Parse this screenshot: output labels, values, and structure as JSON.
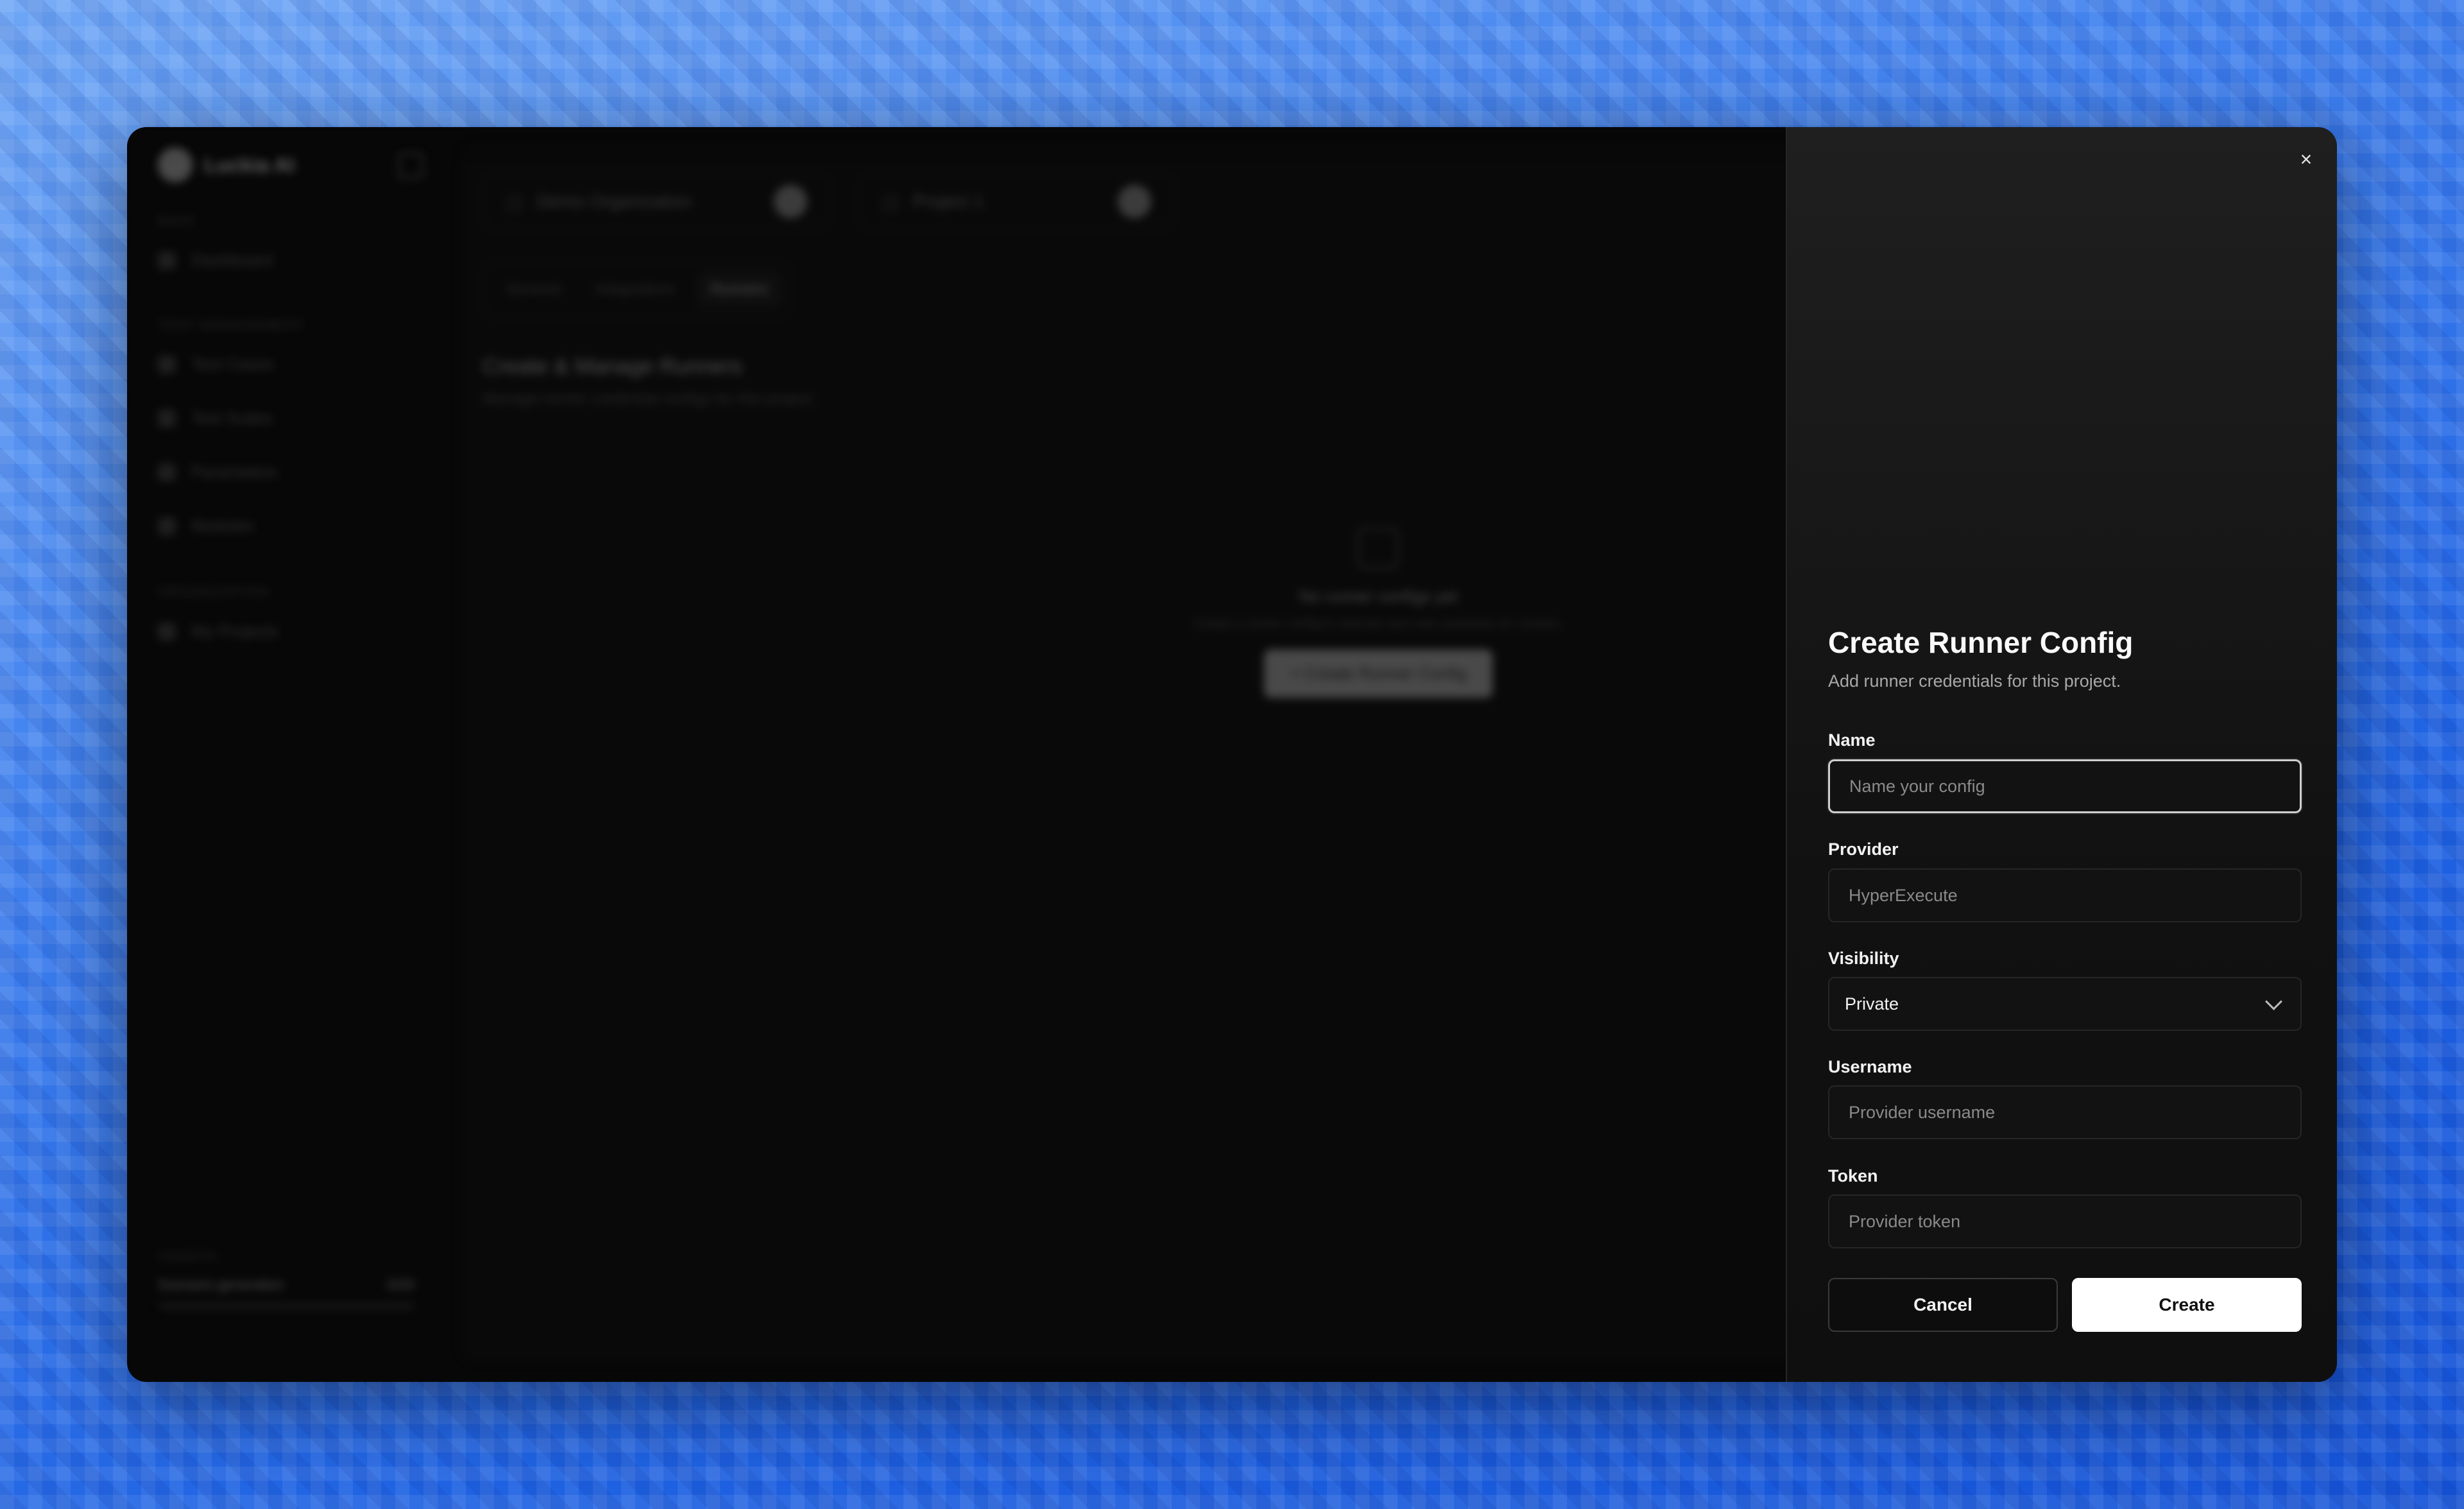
{
  "background_app": {
    "brand": "Luckia AI",
    "sidebar": {
      "sections": [
        {
          "title": "MAIN",
          "items": [
            "Dashboard"
          ]
        },
        {
          "title": "TEST MANAGEMENT",
          "items": [
            "Test Cases",
            "Test Suites",
            "Parameters",
            "Modules"
          ]
        },
        {
          "title": "ORGANIZATION",
          "items": [
            "My Projects"
          ]
        }
      ],
      "credits": {
        "title": "CREDITS",
        "label": "Scenario generation",
        "value": "0/20"
      }
    },
    "org_select": "Demo Organization",
    "project_select": "Project 1",
    "tabs": [
      {
        "label": "General",
        "active": false
      },
      {
        "label": "Integrations",
        "active": false
      },
      {
        "label": "Runners",
        "active": true
      }
    ],
    "heading": "Create & Manage Runners",
    "subheading": "Manage runner credential configs for this project.",
    "empty_state": {
      "title": "No runner configs yet",
      "subtitle": "Create a runner config to execute your test scenarios on runners.",
      "button": "+ Create Runner Config"
    }
  },
  "dialog": {
    "close_icon": "×",
    "title": "Create Runner Config",
    "description": "Add runner credentials for this project.",
    "fields": {
      "name": {
        "label": "Name",
        "placeholder": "Name your config",
        "value": ""
      },
      "provider": {
        "label": "Provider",
        "placeholder": "HyperExecute",
        "value": ""
      },
      "visibility": {
        "label": "Visibility",
        "value": "Private"
      },
      "username": {
        "label": "Username",
        "placeholder": "Provider username",
        "value": ""
      },
      "token": {
        "label": "Token",
        "placeholder": "Provider token",
        "value": ""
      }
    },
    "cancel_label": "Cancel",
    "create_label": "Create"
  }
}
